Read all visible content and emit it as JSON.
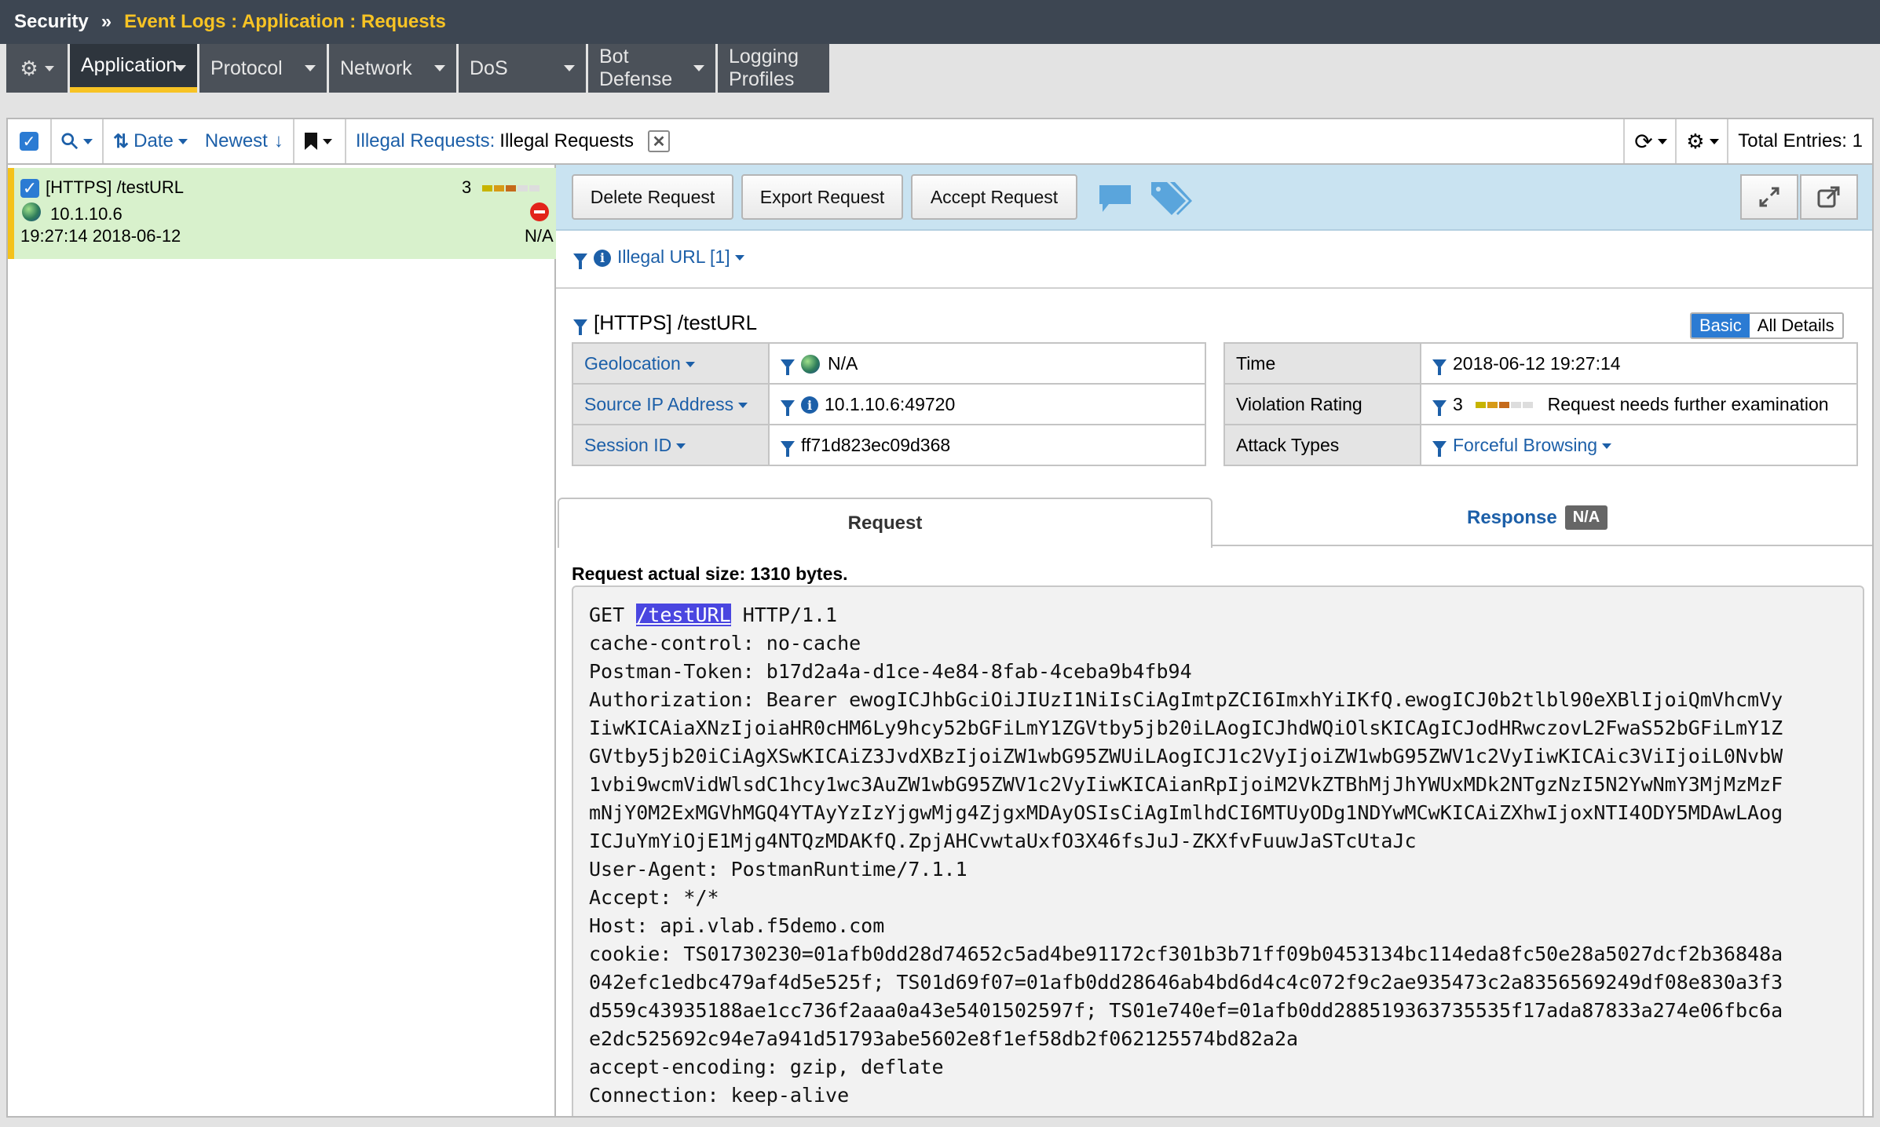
{
  "breadcrumb": {
    "section": "Security",
    "separator": "»",
    "path": "Event Logs : Application : Requests"
  },
  "tabs": [
    {
      "label": "Application"
    },
    {
      "label": "Protocol"
    },
    {
      "label": "Network"
    },
    {
      "label": "DoS"
    },
    {
      "label": "Bot Defense"
    },
    {
      "label": "Logging Profiles"
    }
  ],
  "toolbar": {
    "sort_label": "Date",
    "order_label": "Newest",
    "filter_name": "Illegal Requests:",
    "filter_value": "Illegal Requests",
    "total_label": "Total Entries: 1"
  },
  "list": {
    "item": {
      "title": "[HTTPS] /testURL",
      "rating": "3",
      "ip": "10.1.10.6",
      "geo": "N/A",
      "timestamp": "19:27:14 2018-06-12"
    }
  },
  "actions": {
    "delete": "Delete Request",
    "export": "Export Request",
    "accept": "Accept Request"
  },
  "violation_header": "Illegal URL [1]",
  "request_title": "[HTTPS] /testURL",
  "view_toggle": {
    "basic": "Basic",
    "all": "All Details"
  },
  "left_details": [
    {
      "label": "Geolocation",
      "value": "N/A"
    },
    {
      "label": "Source IP Address",
      "value": "10.1.10.6:49720"
    },
    {
      "label": "Session ID",
      "value": "ff71d823ec09d368"
    }
  ],
  "right_details": [
    {
      "label": "Time",
      "value": "2018-06-12 19:27:14"
    },
    {
      "label": "Violation Rating",
      "rating": "3",
      "value": "Request needs further examination"
    },
    {
      "label": "Attack Types",
      "value": "Forceful Browsing"
    }
  ],
  "subtabs": {
    "request": "Request",
    "response": "Response",
    "response_badge": "N/A"
  },
  "request_size": "Request actual size: 1310 bytes.",
  "request_body": {
    "first_method": "GET ",
    "first_url": "/testURL",
    "first_proto": " HTTP/1.1",
    "lines": [
      "cache-control: no-cache",
      "Postman-Token: b17d2a4a-d1ce-4e84-8fab-4ceba9b4fb94",
      "Authorization: Bearer ewogICJhbGciOiJIUzI1NiIsCiAgImtpZCI6ImxhYiIKfQ.ewogICJ0b2tlbl90eXBlIjoiQmVhcmVy",
      "IiwKICAiaXNzIjoiaHR0cHM6Ly9hcy52bGFiLmY1ZGVtby5jb20iLAogICJhdWQiOlsKICAgICJodHRwczovL2FwaS52bGFiLmY1Z",
      "GVtby5jb20iCiAgXSwKICAiZ3JvdXBzIjoiZW1wbG95ZWUiLAogICJ1c2VyIjoiZW1wbG95ZWV1c2VyIiwKICAic3ViIjoiL0NvbW",
      "1vbi9wcmVidWlsdC1hcy1wc3AuZW1wbG95ZWV1c2VyIiwKICAianRpIjoiM2VkZTBhMjJhYWUxMDk2NTgzNzI5N2YwNmY3MjMzMzF",
      "mNjY0M2ExMGVhMGQ4YTAyYzIzYjgwMjg4ZjgxMDAyOSIsCiAgImlhdCI6MTUyODg1NDYwMCwKICAiZXhwIjoxNTI4ODY5MDAwLAog",
      "ICJuYmYiOjE1Mjg4NTQzMDAKfQ.ZpjAHCvwtaUxfO3X46fsJuJ-ZKXfvFuuwJaSTcUtaJc",
      "User-Agent: PostmanRuntime/7.1.1",
      "Accept: */*",
      "Host: api.vlab.f5demo.com",
      "cookie: TS01730230=01afb0dd28d74652c5ad4be91172cf301b3b71ff09b0453134bc114eda8fc50e28a5027dcf2b36848a",
      "042efc1edbc479af4d5e525f; TS01d69f07=01afb0dd28646ab4bd6d4c4c072f9c2ae935473c2a8356569249df08e830a3f3",
      "d559c43935188ae1cc736f2aaa0a43e5401502597f; TS01e740ef=01afb0dd288519363735535f17ada87833a274e06fbc6a",
      "e2dc525692c94e7a941d51793abe5602e8f1ef58db2f062125574bd82a2a",
      "accept-encoding: gzip, deflate",
      "Connection: keep-alive"
    ]
  },
  "colors": {
    "accent_yellow": "#f7c324",
    "link_blue": "#1c5fa8",
    "selected_row": "#d8f1cc"
  }
}
